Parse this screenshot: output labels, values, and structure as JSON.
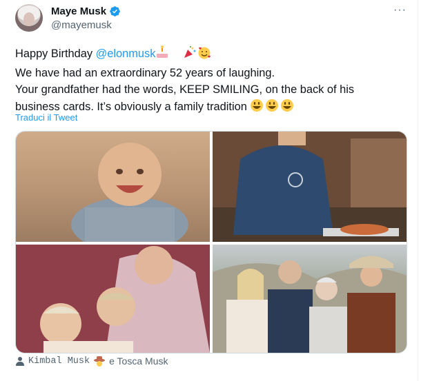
{
  "tweet": {
    "author_name": "Maye Musk",
    "author_handle": "@mayemusk",
    "more_label": "···",
    "text_line1_prefix": "Happy Birthday ",
    "mention": "@elonmusk",
    "text_line2": "We have had an extraordinary 52 years of laughing.",
    "text_line3": "Your grandfather had the words, KEEP SMILING, on the back of his",
    "text_line4": "business cards. It’s obviously a family tradition ",
    "translate_label": "Traduci il Tweet",
    "tag_user1": "Kimbal Musk",
    "tag_sep": "e Tosca Musk"
  },
  "icons": {
    "verified": "verified-badge-icon",
    "more": "more-options-icon",
    "person": "person-tag-icon",
    "emoji": [
      "birthday-cake-emoji",
      "party-popper-emoji",
      "smiling-face-hearts-emoji",
      "grinning-face-emoji",
      "cowboy-hat-emoji"
    ]
  },
  "colors": {
    "link": "#1d9bf0",
    "secondary_text": "#536471",
    "border": "#cfd9de",
    "verified": "#1d9bf0"
  }
}
